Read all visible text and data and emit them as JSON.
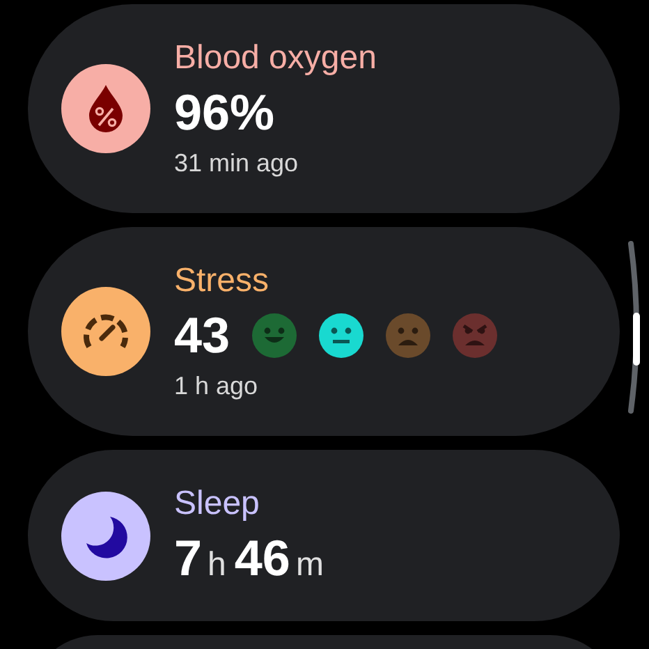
{
  "cards": [
    {
      "kind": "oxygen",
      "title": "Blood oxygen",
      "color": "#f7aea6",
      "value": "96%",
      "time": "31 min ago"
    },
    {
      "kind": "stress",
      "title": "Stress",
      "color": "#f9b16a",
      "value": "43",
      "time": "1 h ago",
      "faces": [
        {
          "kind": "happy",
          "color": "#1d6a35"
        },
        {
          "kind": "neutral",
          "color": "#19d9d0"
        },
        {
          "kind": "sad",
          "color": "#6a4a2b"
        },
        {
          "kind": "angry",
          "color": "#6b2f2e"
        }
      ]
    },
    {
      "kind": "sleep",
      "title": "Sleep",
      "color": "#c9c2ff",
      "parts": [
        {
          "text": "7",
          "kind": "number"
        },
        {
          "text": "h",
          "kind": "unit"
        },
        {
          "text": "46",
          "kind": "number"
        },
        {
          "text": "m",
          "kind": "unit"
        }
      ]
    },
    {
      "kind": "empty"
    }
  ]
}
